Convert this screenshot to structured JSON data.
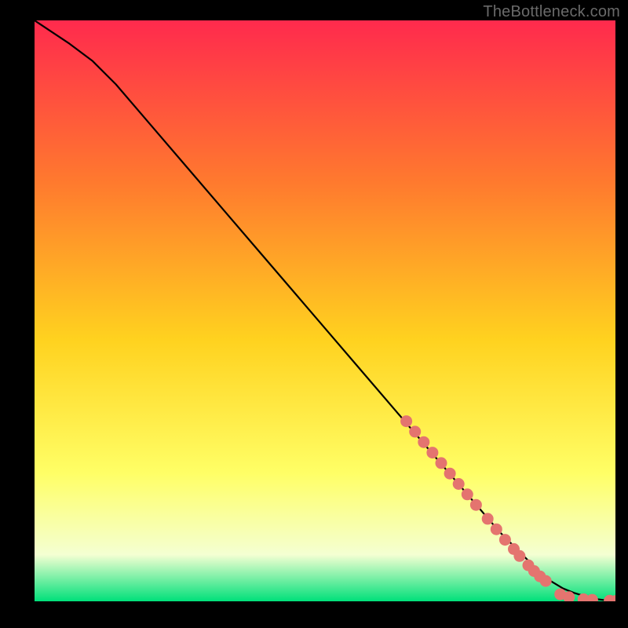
{
  "watermark": "TheBottleneck.com",
  "colors": {
    "background_black": "#000000",
    "gradient_top": "#ff2a4d",
    "gradient_mid1": "#ff7a2e",
    "gradient_mid2": "#ffd21f",
    "gradient_mid3": "#ffff66",
    "gradient_mid4": "#f4ffd2",
    "gradient_bottom": "#00e07a",
    "curve_stroke": "#000000",
    "dot_fill": "#e4746f"
  },
  "chart_data": {
    "type": "line",
    "title": "",
    "xlabel": "",
    "ylabel": "",
    "xlim": [
      0,
      100
    ],
    "ylim": [
      0,
      100
    ],
    "grid": false,
    "legend": false,
    "series": [
      {
        "name": "curve",
        "x": [
          0,
          3,
          6,
          10,
          14,
          20,
          26,
          32,
          38,
          44,
          50,
          56,
          62,
          68,
          74,
          80,
          84,
          87,
          89,
          91,
          93,
          95,
          97,
          99,
          100
        ],
        "y": [
          100,
          98,
          96,
          93,
          89,
          82,
          75,
          68,
          61,
          54,
          47,
          40,
          33,
          26,
          19,
          12,
          8,
          5,
          3.4,
          2.2,
          1.4,
          0.8,
          0.35,
          0.1,
          0
        ]
      }
    ],
    "dots": {
      "name": "highlighted-points",
      "color": "#e4746f",
      "points": [
        {
          "x": 64.0,
          "y": 31.0
        },
        {
          "x": 65.5,
          "y": 29.2
        },
        {
          "x": 67.0,
          "y": 27.4
        },
        {
          "x": 68.5,
          "y": 25.6
        },
        {
          "x": 70.0,
          "y": 23.8
        },
        {
          "x": 71.5,
          "y": 22.0
        },
        {
          "x": 73.0,
          "y": 20.2
        },
        {
          "x": 74.5,
          "y": 18.4
        },
        {
          "x": 76.0,
          "y": 16.6
        },
        {
          "x": 78.0,
          "y": 14.2
        },
        {
          "x": 79.5,
          "y": 12.4
        },
        {
          "x": 81.0,
          "y": 10.6
        },
        {
          "x": 82.5,
          "y": 9.0
        },
        {
          "x": 83.5,
          "y": 7.8
        },
        {
          "x": 85.0,
          "y": 6.2
        },
        {
          "x": 86.0,
          "y": 5.2
        },
        {
          "x": 87.0,
          "y": 4.3
        },
        {
          "x": 88.0,
          "y": 3.5
        },
        {
          "x": 90.5,
          "y": 1.2
        },
        {
          "x": 92.0,
          "y": 0.7
        },
        {
          "x": 94.5,
          "y": 0.35
        },
        {
          "x": 96.0,
          "y": 0.25
        },
        {
          "x": 99.0,
          "y": 0.1
        },
        {
          "x": 100.0,
          "y": 0.05
        }
      ]
    }
  }
}
